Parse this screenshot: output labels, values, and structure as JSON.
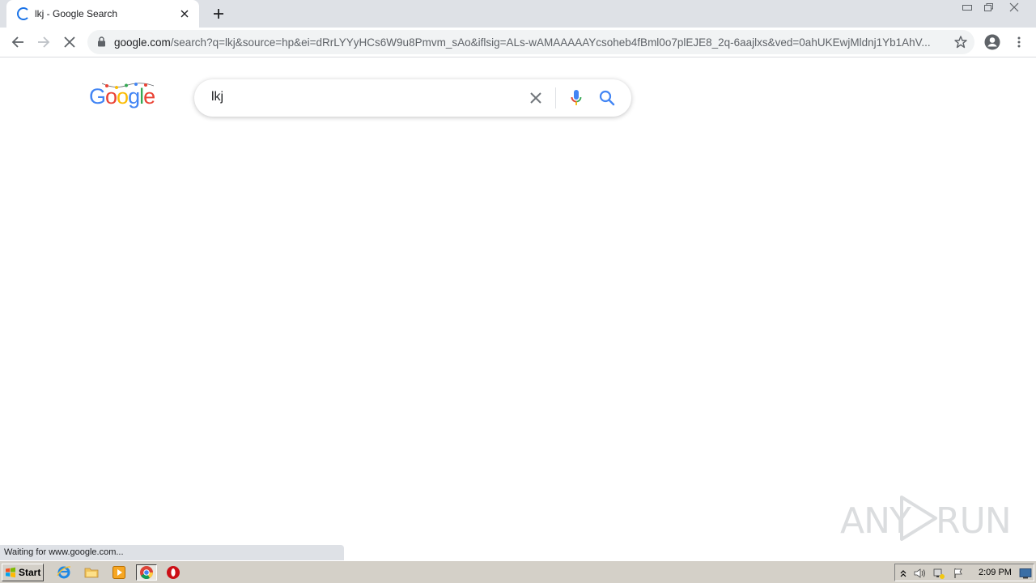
{
  "browser": {
    "tab_title": "lkj - Google Search",
    "url_host": "google.com",
    "url_path": "/search?q=lkj&source=hp&ei=dRrLYYyHCs6W9u8Pmvm_sAo&iflsig=ALs-wAMAAAAAYcsoheb4fBml0o7plEJE8_2q-6aajlxs&ved=0ahUKEwjMldnj1Yb1AhV..."
  },
  "google": {
    "logo_letters": [
      "G",
      "o",
      "o",
      "g",
      "l",
      "e"
    ],
    "logo_colors": [
      "#4285f4",
      "#ea4335",
      "#fbbc05",
      "#4285f4",
      "#34a853",
      "#ea4335"
    ],
    "query": "lkj"
  },
  "status_text": "Waiting for www.google.com...",
  "watermark": {
    "left": "ANY",
    "right": "RUN"
  },
  "taskbar": {
    "start_label": "Start",
    "clock": "2:09 PM"
  },
  "colors": {
    "tab_strip": "#dee1e6",
    "accent": "#1a73e8",
    "taskbar": "#d4d0c8"
  }
}
